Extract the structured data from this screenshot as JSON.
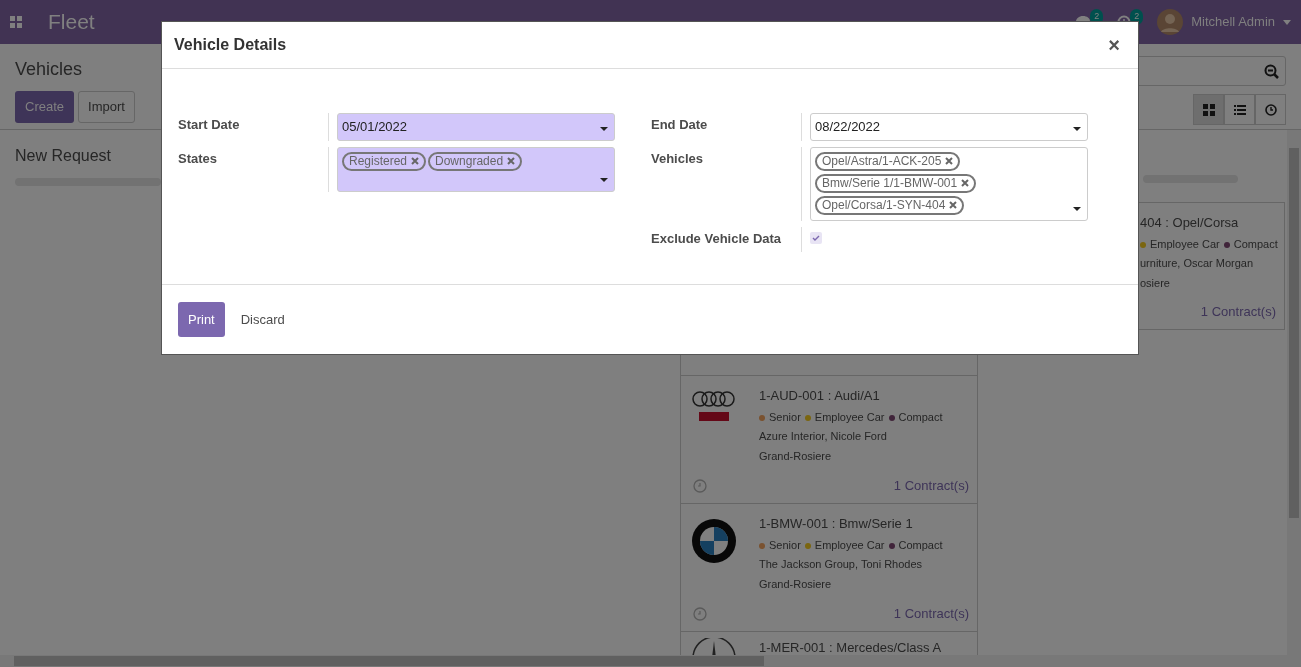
{
  "navbar": {
    "app_name": "Fleet",
    "messages_count": "2",
    "activities_count": "2",
    "user": "Mitchell Admin"
  },
  "control_panel": {
    "breadcrumb": "Vehicles",
    "buttons": [
      {
        "label": "Create",
        "kind": "primary"
      },
      {
        "label": "Import",
        "kind": "secondary"
      }
    ],
    "views": [
      {
        "kind": "kanban",
        "selected": true
      },
      {
        "kind": "list",
        "selected": false
      },
      {
        "kind": "activity",
        "selected": false
      }
    ]
  },
  "kanban": {
    "columns": [
      {
        "title": "New Request"
      },
      {
        "cards": [
          {
            "title": "1-AUD-001 : Audi/A1",
            "tags": [
              {
                "label": "Senior",
                "color": "#7a5230"
              },
              {
                "label": "Employee Car",
                "color": "#7b6610"
              },
              {
                "label": "Compact",
                "color": "#40243a"
              }
            ],
            "driver": "Azure Interior, Nicole Ford",
            "location": "Grand-Rosiere",
            "contracts": "1 Contract(s)"
          },
          {
            "title": "1-BMW-001 : Bmw/Serie 1",
            "tags": [
              {
                "label": "Senior",
                "color": "#7a5230"
              },
              {
                "label": "Employee Car",
                "color": "#7b6610"
              },
              {
                "label": "Compact",
                "color": "#40243a"
              }
            ],
            "driver": "The Jackson Group, Toni Rhodes",
            "location": "Grand-Rosiere",
            "contracts": "1 Contract(s)"
          },
          {
            "title": "1-MER-001 : Mercedes/Class A"
          }
        ]
      },
      {
        "cards": [
          {
            "title": "404 : Opel/Corsa",
            "tags": [
              {
                "label": "Employee Car",
                "color": "#7b6610"
              },
              {
                "label": "Compact",
                "color": "#40243a"
              }
            ],
            "driver": "urniture, Oscar Morgan",
            "location": "osiere",
            "contracts": "1 Contract(s)"
          }
        ]
      }
    ]
  },
  "dialog": {
    "title": "Vehicle Details",
    "close": "×",
    "left_fields": [
      {
        "label": "Start Date",
        "kind": "date",
        "value": "05/01/2022",
        "required": true
      },
      {
        "label": "States",
        "kind": "tags",
        "tags": [
          "Registered",
          "Downgraded"
        ],
        "required": true
      }
    ],
    "right_fields": [
      {
        "label": "End Date",
        "kind": "date",
        "value": "08/22/2022",
        "required": false
      },
      {
        "label": "Vehicles",
        "kind": "tags",
        "tags": [
          "Opel/Astra/1-ACK-205",
          "Bmw/Serie 1/1-BMW-001",
          "Opel/Corsa/1-SYN-404"
        ],
        "required": false
      },
      {
        "label": "Exclude Vehicle Data",
        "kind": "checkbox",
        "checked": true
      }
    ],
    "buttons": [
      {
        "label": "Print",
        "kind": "primary"
      },
      {
        "label": "Discard",
        "kind": "link"
      }
    ]
  }
}
